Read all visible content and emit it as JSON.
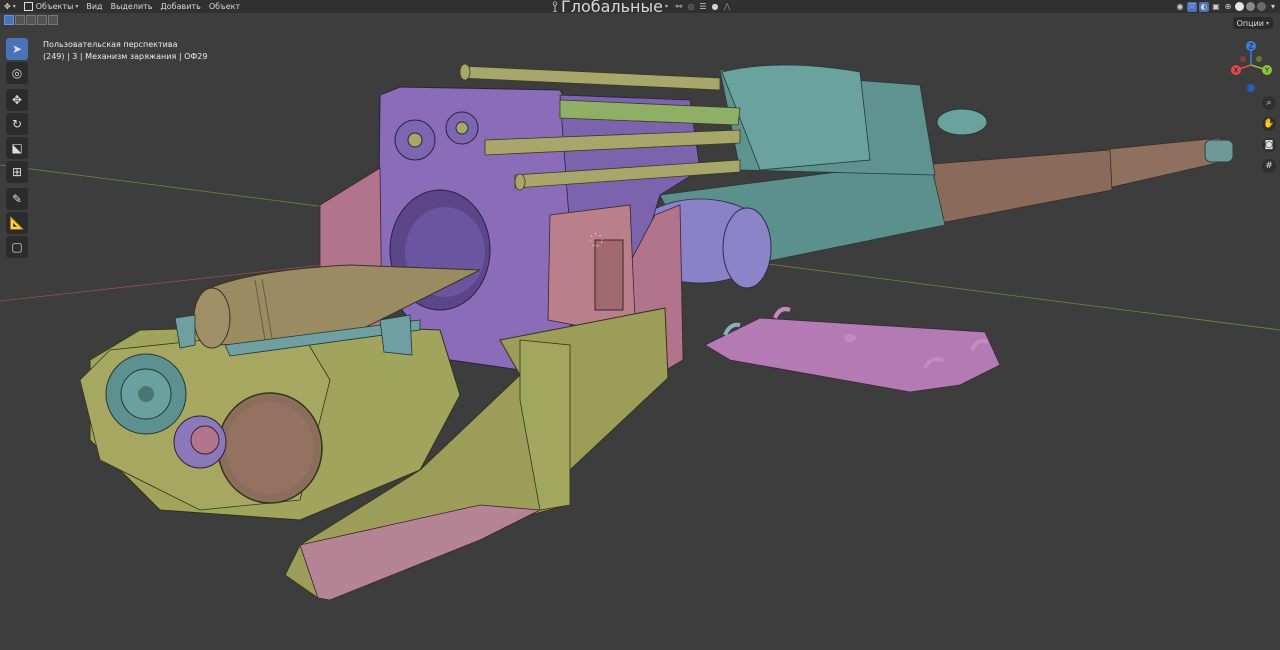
{
  "header": {
    "editor_menu_icon": "editor-type-icon",
    "mode_label": "Объекты",
    "menus": [
      "Вид",
      "Выделить",
      "Добавить",
      "Объект"
    ],
    "orientation_label": "Глобальные"
  },
  "toolbar": {
    "options_label": "Опции",
    "tools": [
      "select-box-icon",
      "cursor-icon",
      "move-icon",
      "rotate-icon",
      "scale-icon",
      "transform-icon",
      "annotate-icon",
      "measure-icon",
      "add-cube-icon"
    ]
  },
  "overlay": {
    "view_name": "Пользовательская перспектива",
    "object_info": "(249) | 3 | Механизм заряжания | ОФ29"
  },
  "gizmo": {
    "axes": [
      "Z",
      "X",
      "Y"
    ],
    "colors": {
      "x": "#e54a4a",
      "y": "#8cc43a",
      "z": "#3f7fd8",
      "negative_z": "#2a5db0"
    }
  },
  "scene_colors": {
    "background": "#3d3d3d",
    "header": "#303030",
    "accent": "#4a72b8",
    "purple": "#8a6cb8",
    "pink": "#b2748d",
    "olive": "#9b9d58",
    "teal": "#5b908d",
    "brown": "#8c6d5c",
    "tan": "#9a8b62"
  }
}
